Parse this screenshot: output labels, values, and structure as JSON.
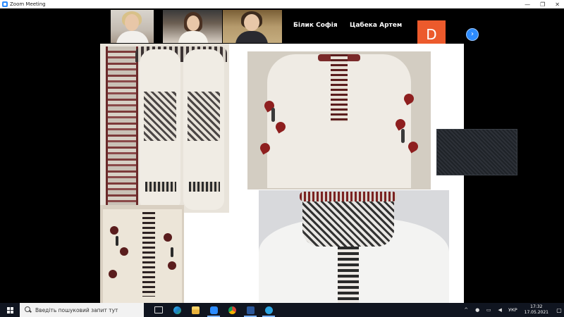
{
  "window": {
    "title": "Zoom Meeting",
    "controls": [
      "—",
      "❐",
      "✕"
    ]
  },
  "gallery": {
    "participants": [
      {
        "name": "Білик Софія"
      },
      {
        "name": "Цабека Артем"
      }
    ],
    "avatar_letter": "D",
    "avatar_color": "#ec5a2c",
    "next_icon": "›"
  },
  "taskbar": {
    "search_placeholder": "Введіть пошуковий запит тут",
    "apps": [
      "task-view",
      "edge",
      "file-explorer",
      "zoom",
      "chrome",
      "word",
      "telegram"
    ],
    "language": "УКР",
    "time": "17:32",
    "date": "17.05.2021"
  },
  "colors": {
    "zoom_blue": "#2d8cff",
    "taskbar_bg": "#101520"
  }
}
